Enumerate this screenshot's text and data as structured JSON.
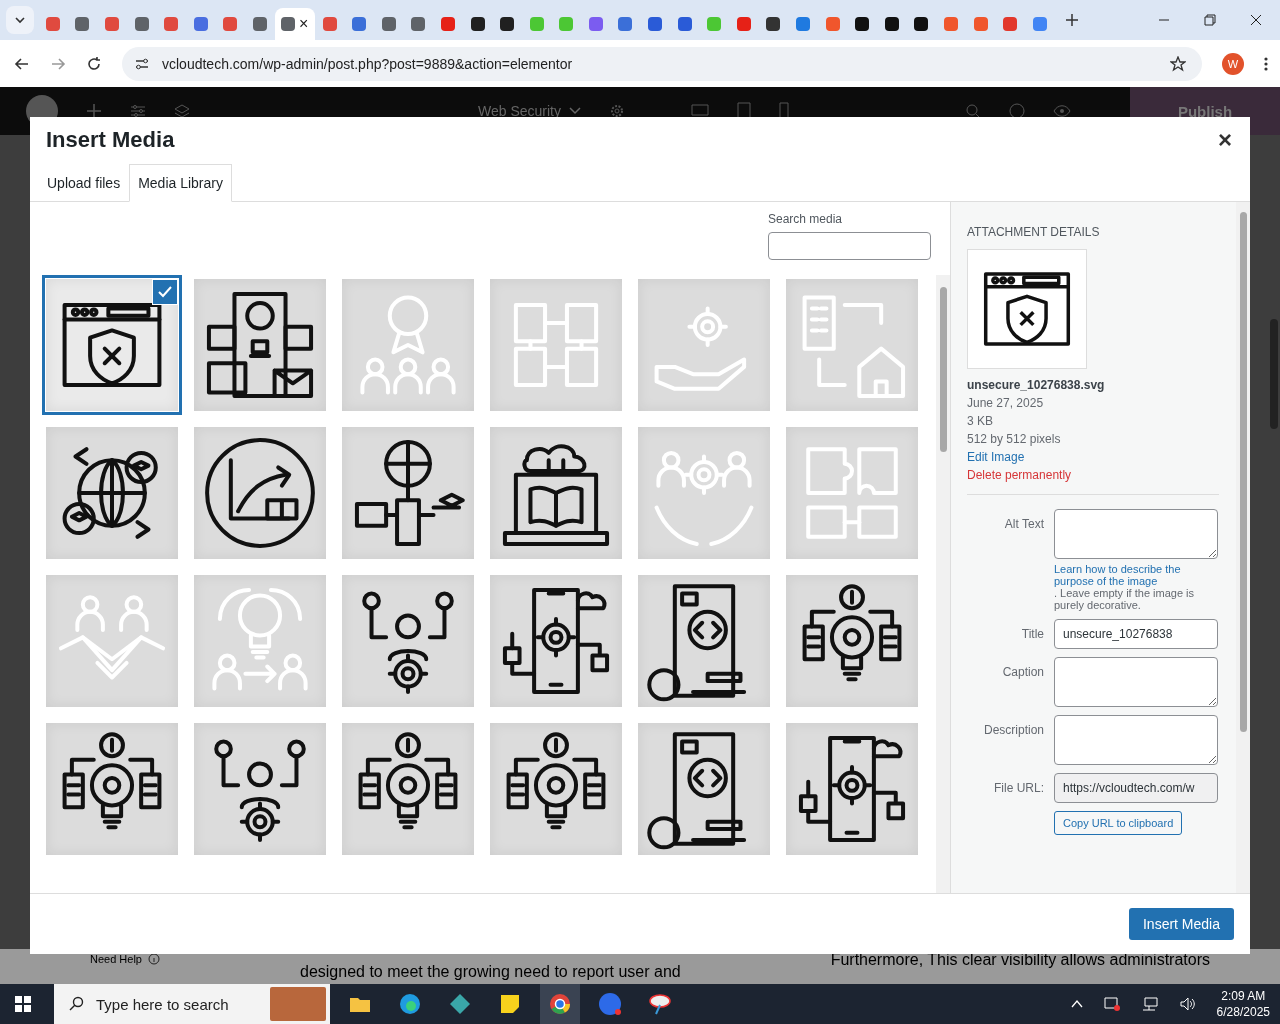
{
  "browser": {
    "tabs": [
      {
        "color": "#e04a3f",
        "selected": false
      },
      {
        "color": "#5f6368",
        "selected": false
      },
      {
        "color": "#e04a3f",
        "selected": false
      },
      {
        "color": "#5f6368",
        "selected": false
      },
      {
        "color": "#e04a3f",
        "selected": false
      },
      {
        "color": "#4a6ee0",
        "selected": false
      },
      {
        "color": "#e04a3f",
        "selected": false
      },
      {
        "color": "#5f6368",
        "selected": false
      },
      {
        "color": "#5f6368",
        "selected": true,
        "close": "×"
      },
      {
        "color": "#e04a3f",
        "selected": false
      },
      {
        "color": "#3b6fd8",
        "selected": false
      },
      {
        "color": "#5f6368",
        "selected": false
      },
      {
        "color": "#5f6368",
        "selected": false
      },
      {
        "color": "#e62117",
        "selected": false
      },
      {
        "color": "#202020",
        "selected": false
      },
      {
        "color": "#202020",
        "selected": false
      },
      {
        "color": "#4cc734",
        "selected": false
      },
      {
        "color": "#4cc734",
        "selected": false
      },
      {
        "color": "#7b5cf0",
        "selected": false
      },
      {
        "color": "#3b6fd8",
        "selected": false
      },
      {
        "color": "#2a5bd7",
        "selected": false
      },
      {
        "color": "#2a5bd7",
        "selected": false
      },
      {
        "color": "#4cc734",
        "selected": false
      },
      {
        "color": "#e62117",
        "selected": false
      },
      {
        "color": "#333333",
        "selected": false
      },
      {
        "color": "#1f7ae0",
        "selected": false
      },
      {
        "color": "#f0562c",
        "selected": false
      },
      {
        "color": "#111111",
        "selected": false
      },
      {
        "color": "#111111",
        "selected": false
      },
      {
        "color": "#111111",
        "selected": false
      },
      {
        "color": "#f0562c",
        "selected": false
      },
      {
        "color": "#f0562c",
        "selected": false
      },
      {
        "color": "#e2382c",
        "selected": false
      },
      {
        "color": "#4285f4",
        "selected": false
      }
    ],
    "url": "vcloudtech.com/wp-admin/post.php?post=9889&action=elementor",
    "profile": "W"
  },
  "editor_bar": {
    "page_title": "Web Security",
    "publish": "Publish"
  },
  "background_text": {
    "help": "Need Help",
    "left_paragraph": "designed to meet the growing need to report user and",
    "right_paragraph": "Furthermore, This clear visibility allows administrators"
  },
  "modal": {
    "title": "Insert Media",
    "close": "×",
    "tabs": [
      {
        "label": "Upload files",
        "selected": false
      },
      {
        "label": "Media Library",
        "selected": true
      }
    ],
    "search": {
      "label": "Search media"
    },
    "items": [
      {
        "kind": "shield-window",
        "faded": false,
        "selected": true
      },
      {
        "kind": "skull-devices",
        "faded": false,
        "selected": false
      },
      {
        "kind": "award-people",
        "faded": true,
        "selected": false
      },
      {
        "kind": "hands",
        "faded": true,
        "selected": false
      },
      {
        "kind": "gear-hand",
        "faded": true,
        "selected": false
      },
      {
        "kind": "building-house",
        "faded": true,
        "selected": false
      },
      {
        "kind": "globe-caps",
        "faded": false,
        "selected": false
      },
      {
        "kind": "chart-book",
        "faded": false,
        "selected": false
      },
      {
        "kind": "globe-devices",
        "faded": false,
        "selected": false
      },
      {
        "kind": "laptop-book",
        "faded": false,
        "selected": false
      },
      {
        "kind": "gear-hands",
        "faded": true,
        "selected": false
      },
      {
        "kind": "puzzle",
        "faded": true,
        "selected": false
      },
      {
        "kind": "handshake",
        "faded": true,
        "selected": false
      },
      {
        "kind": "bulb-people",
        "faded": true,
        "selected": false
      },
      {
        "kind": "team-gear",
        "faded": false,
        "selected": false
      },
      {
        "kind": "phone-gear",
        "faded": false,
        "selected": false
      },
      {
        "kind": "phone-code",
        "faded": false,
        "selected": false
      },
      {
        "kind": "bulb-dollar",
        "faded": false,
        "selected": false
      },
      {
        "kind": "bulb-dollar",
        "faded": false,
        "selected": false
      },
      {
        "kind": "team-gear",
        "faded": false,
        "selected": false
      },
      {
        "kind": "bulb-dollar",
        "faded": false,
        "selected": false
      },
      {
        "kind": "bulb-dollar",
        "faded": false,
        "selected": false
      },
      {
        "kind": "phone-code",
        "faded": false,
        "selected": false
      },
      {
        "kind": "phone-gear",
        "faded": false,
        "selected": false
      }
    ],
    "details": {
      "heading": "ATTACHMENT DETAILS",
      "filename": "unsecure_10276838.svg",
      "date": "June 27, 2025",
      "size": "3 KB",
      "dimensions": "512 by 512 pixels",
      "edit": "Edit Image",
      "delete": "Delete permanently",
      "alt_label": "Alt Text",
      "alt_help_link": "Learn how to describe the purpose of the image",
      "alt_help_rest": ". Leave empty if the image is purely decorative.",
      "title_label": "Title",
      "title_value": "unsecure_10276838",
      "caption_label": "Caption",
      "description_label": "Description",
      "url_label": "File URL:",
      "url_value": "https://vcloudtech.com/w",
      "copy": "Copy URL to clipboard"
    },
    "insert": "Insert Media"
  },
  "taskbar": {
    "search": "Type here to search",
    "time": "2:09 AM",
    "date": "6/28/2025"
  }
}
